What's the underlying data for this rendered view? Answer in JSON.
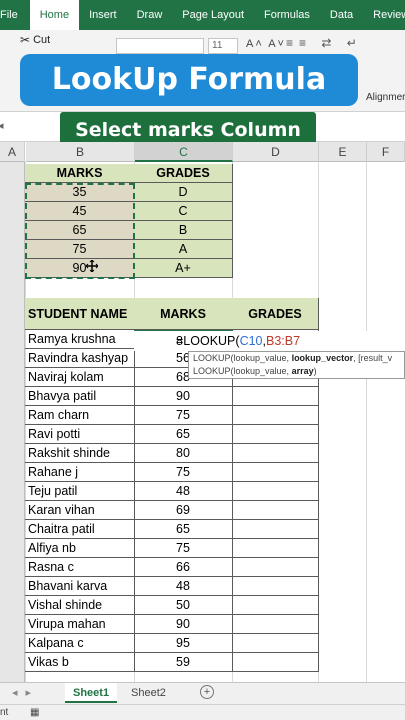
{
  "ribbon_tabs": [
    "File",
    "Home",
    "Insert",
    "Draw",
    "Page Layout",
    "Formulas",
    "Data",
    "Review"
  ],
  "active_tab": "Home",
  "ribbon": {
    "cut_label": "Cut",
    "font_size": "11",
    "alignment_label": "Alignmer"
  },
  "banners": {
    "title": "LookUp Formula",
    "subtitle": "Select marks Column"
  },
  "columns": [
    "A",
    "B",
    "C",
    "D",
    "E",
    "F"
  ],
  "grade_table": {
    "headers": [
      "MARKS",
      "GRADES"
    ],
    "rows": [
      [
        "35",
        "D"
      ],
      [
        "45",
        "C"
      ],
      [
        "65",
        "B"
      ],
      [
        "75",
        "A"
      ],
      [
        "90",
        "A+"
      ]
    ]
  },
  "student_table": {
    "headers": [
      "STUDENT NAME",
      "MARKS",
      "GRADES"
    ],
    "rows": [
      [
        "Ramya krushna",
        "8"
      ],
      [
        "Ravindra kashyap",
        "56"
      ],
      [
        "Naviraj kolam",
        "68"
      ],
      [
        "Bhavya patil",
        "90"
      ],
      [
        "Ram charn",
        "75"
      ],
      [
        "Ravi potti",
        "65"
      ],
      [
        "Rakshit shinde",
        "80"
      ],
      [
        "Rahane j",
        "75"
      ],
      [
        "Teju patil",
        "48"
      ],
      [
        "Karan vihan",
        "69"
      ],
      [
        "Chaitra patil",
        "65"
      ],
      [
        "Alfiya nb",
        "75"
      ],
      [
        "Rasna c",
        "66"
      ],
      [
        "Bhavani karva",
        "48"
      ],
      [
        "Vishal shinde",
        "50"
      ],
      [
        "Virupa mahan",
        "90"
      ],
      [
        "Kalpana c",
        "95"
      ],
      [
        "Vikas b",
        "59"
      ]
    ]
  },
  "formula": {
    "prefix": "=LOOKUP(",
    "ref1": "C10",
    "sep": ",",
    "ref2": "B3:B7"
  },
  "tooltip": {
    "line1_a": "LOOKUP(lookup_value, ",
    "line1_b": "lookup_vector",
    "line1_c": ", [result_v",
    "line2_a": "LOOKUP(lookup_value, ",
    "line2_b": "array",
    "line2_c": ")"
  },
  "sheets": [
    "Sheet1",
    "Sheet2"
  ],
  "active_sheet": "Sheet1",
  "status_text": "nt"
}
